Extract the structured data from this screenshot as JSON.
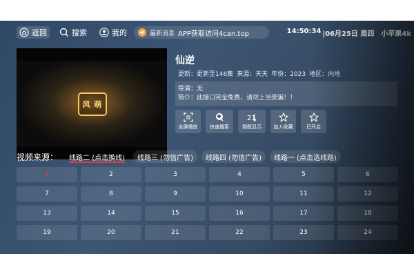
{
  "topbar": {
    "back_label": "返回",
    "search_label": "搜索",
    "mine_label": "我的",
    "news_tag": "最新消息",
    "news_text": "APP获取访问4can.top",
    "time": "14:50:34",
    "date": "|06月25日 周四",
    "brand": "小苹果4k"
  },
  "video": {
    "logo_text": "风 萌"
  },
  "detail": {
    "title": "仙逆",
    "update": "更新：更新至146集",
    "source": "来源：天天",
    "year": "年份：2023",
    "region": "地区：内地",
    "director": "导演：无",
    "intro": "简介：此接口完全免费，请勿上当受骗！！"
  },
  "actions": [
    {
      "label": "全屏播放",
      "icon": "fullscreen-icon"
    },
    {
      "label": "快速搜索",
      "icon": "search-icon"
    },
    {
      "label": "倒叙显示",
      "icon": "sort-icon"
    },
    {
      "label": "加入收藏",
      "icon": "star-icon"
    },
    {
      "label": "已开启",
      "icon": "star-icon"
    }
  ],
  "sources": {
    "label": "视频来源：",
    "items": [
      "线路二 (点击换线)",
      "线路三 (勿信广告)",
      "线路四 (勿信广告)",
      "线路一 (点击选线路)"
    ],
    "active_index": 0
  },
  "episodes": [
    "1",
    "2",
    "3",
    "4",
    "5",
    "6",
    "7",
    "8",
    "9",
    "10",
    "11",
    "12",
    "13",
    "14",
    "15",
    "16",
    "17",
    "18",
    "19",
    "20",
    "21",
    "22",
    "23",
    "24"
  ],
  "current_episode": "1",
  "colors": {
    "accent": "#e23b3b",
    "news_badge": "#f0a64a"
  }
}
